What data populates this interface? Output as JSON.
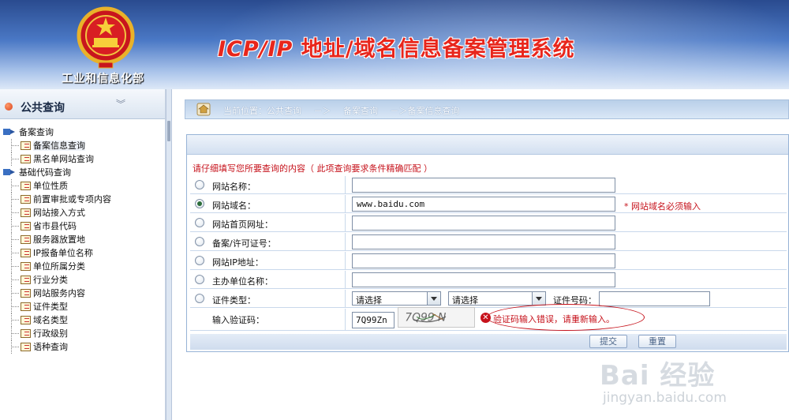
{
  "header": {
    "ministry": "工业和信息化部",
    "title_latin": "ICP/IP",
    "title_cn": " 地址/域名信息备案管理系统"
  },
  "sidebar": {
    "title": "公共查询",
    "groups": [
      {
        "label": "备案查询",
        "items": [
          "备案信息查询",
          "黑名单网站查询"
        ]
      },
      {
        "label": "基础代码查询",
        "items": [
          "单位性质",
          "前置审批或专项内容",
          "网站接入方式",
          "省市县代码",
          "服务器放置地",
          "IP报备单位名称",
          "单位所属分类",
          "行业分类",
          "网站服务内容",
          "证件类型",
          "域名类型",
          "行政级别",
          "语种查询"
        ]
      }
    ]
  },
  "breadcrumb": {
    "prefix": "当前位置：公共查询",
    "sep1": "－＞",
    "mid": "备案查询",
    "tail": "－＞备案信息查询"
  },
  "form": {
    "hint": "请仔细填写您所要查询的内容（ 此项查询要求条件精确匹配 ）",
    "fields": [
      {
        "label": "网站名称：",
        "value": "",
        "selected": false
      },
      {
        "label": "网站域名：",
        "value": "www.baidu.com",
        "selected": true,
        "required_note": "* 网站域名必须输入"
      },
      {
        "label": "网站首页网址：",
        "value": "",
        "selected": false
      },
      {
        "label": "备案/许可证号：",
        "value": "",
        "selected": false
      },
      {
        "label": "网站IP地址：",
        "value": "",
        "selected": false
      },
      {
        "label": "主办单位名称：",
        "value": "",
        "selected": false
      }
    ],
    "cert": {
      "label": "证件类型：",
      "select1": "请选择",
      "select2": "请选择",
      "number_label": "证件号码："
    },
    "captcha": {
      "label": "输入验证码：",
      "value": "7Q99Zn",
      "image_text": "7Q99 N",
      "error": "验证码输入错误，请重新输入。"
    },
    "buttons": {
      "submit": "提交",
      "reset": "重置"
    }
  },
  "watermark": {
    "logo": "Bai 经验",
    "url": "jingyan.baidu.com"
  },
  "colors": {
    "accent_red": "#c6121b",
    "header_blue": "#2a4b8f"
  }
}
